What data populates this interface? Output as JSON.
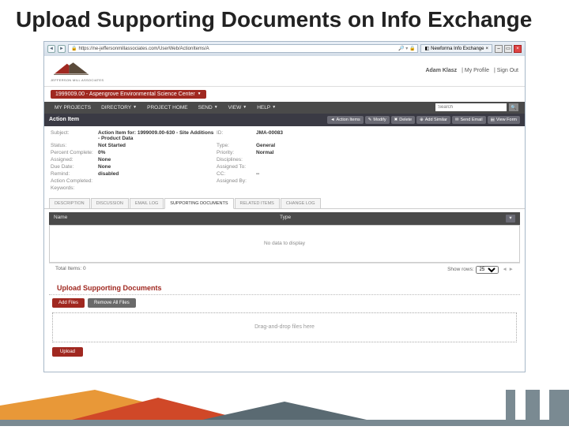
{
  "slide": {
    "title": "Upload Supporting Documents on Info Exchange"
  },
  "browser": {
    "url": "https://ne-jeffersonmillassociates.com/UserWeb/ActionItems/A",
    "tab": "Newforma Info Exchange"
  },
  "user": {
    "name": "Adam Klasz",
    "profile": "My Profile",
    "signout": "Sign Out"
  },
  "project": {
    "selected": "1999009.00 - Aspengrove Environmental Science Center"
  },
  "menu": {
    "items": [
      "MY PROJECTS",
      "DIRECTORY",
      "PROJECT HOME",
      "SEND",
      "VIEW",
      "HELP"
    ],
    "search_ph": "Search"
  },
  "section": {
    "title": "Action Item",
    "buttons": {
      "actionitems": "Action Items",
      "modify": "Modify",
      "delete": "Delete",
      "addsimilar": "Add Similar",
      "sendemail": "Send Email",
      "viewform": "View Form"
    }
  },
  "details": {
    "subject_lbl": "Subject:",
    "subject_val": "Action Item for: 1999009.00-630 - Site Additions - Product Data",
    "id_lbl": "ID:",
    "id_val": "JMA-00083",
    "status_lbl": "Status:",
    "status_val": "Not Started",
    "type_lbl": "Type:",
    "type_val": "General",
    "pct_lbl": "Percent Complete:",
    "pct_val": "0%",
    "priority_lbl": "Priority:",
    "priority_val": "Normal",
    "assigned_lbl": "Assigned:",
    "assigned_val": "None",
    "disciplines_lbl": "Disciplines:",
    "disciplines_val": "",
    "due_lbl": "Due Date:",
    "due_val": "None",
    "assignedto_lbl": "Assigned To:",
    "assignedto_val": "",
    "remind_lbl": "Remind:",
    "remind_val": "disabled",
    "cc_lbl": "CC:",
    "cc_val": "--",
    "acdate_lbl": "Action Completed:",
    "acdate_val": "",
    "assignedby_lbl": "Assigned By:",
    "assignedby_val": "",
    "keywords_lbl": "Keywords:",
    "keywords_val": ""
  },
  "tabs": {
    "desc": "DESCRIPTION",
    "disc": "DISCUSSION",
    "email": "EMAIL LOG",
    "support": "SUPPORTING DOCUMENTS",
    "related": "RELATED ITEMS",
    "change": "CHANGE LOG"
  },
  "grid": {
    "col_name": "Name",
    "col_type": "Type",
    "empty": "No data to display",
    "total": "Total Items: 0",
    "showrows": "Show rows:",
    "pagesize": "25"
  },
  "upload": {
    "heading": "Upload Supporting Documents",
    "add": "Add Files",
    "remove": "Remove All Files",
    "drop": "Drag-and-drop files here",
    "submit": "Upload"
  }
}
